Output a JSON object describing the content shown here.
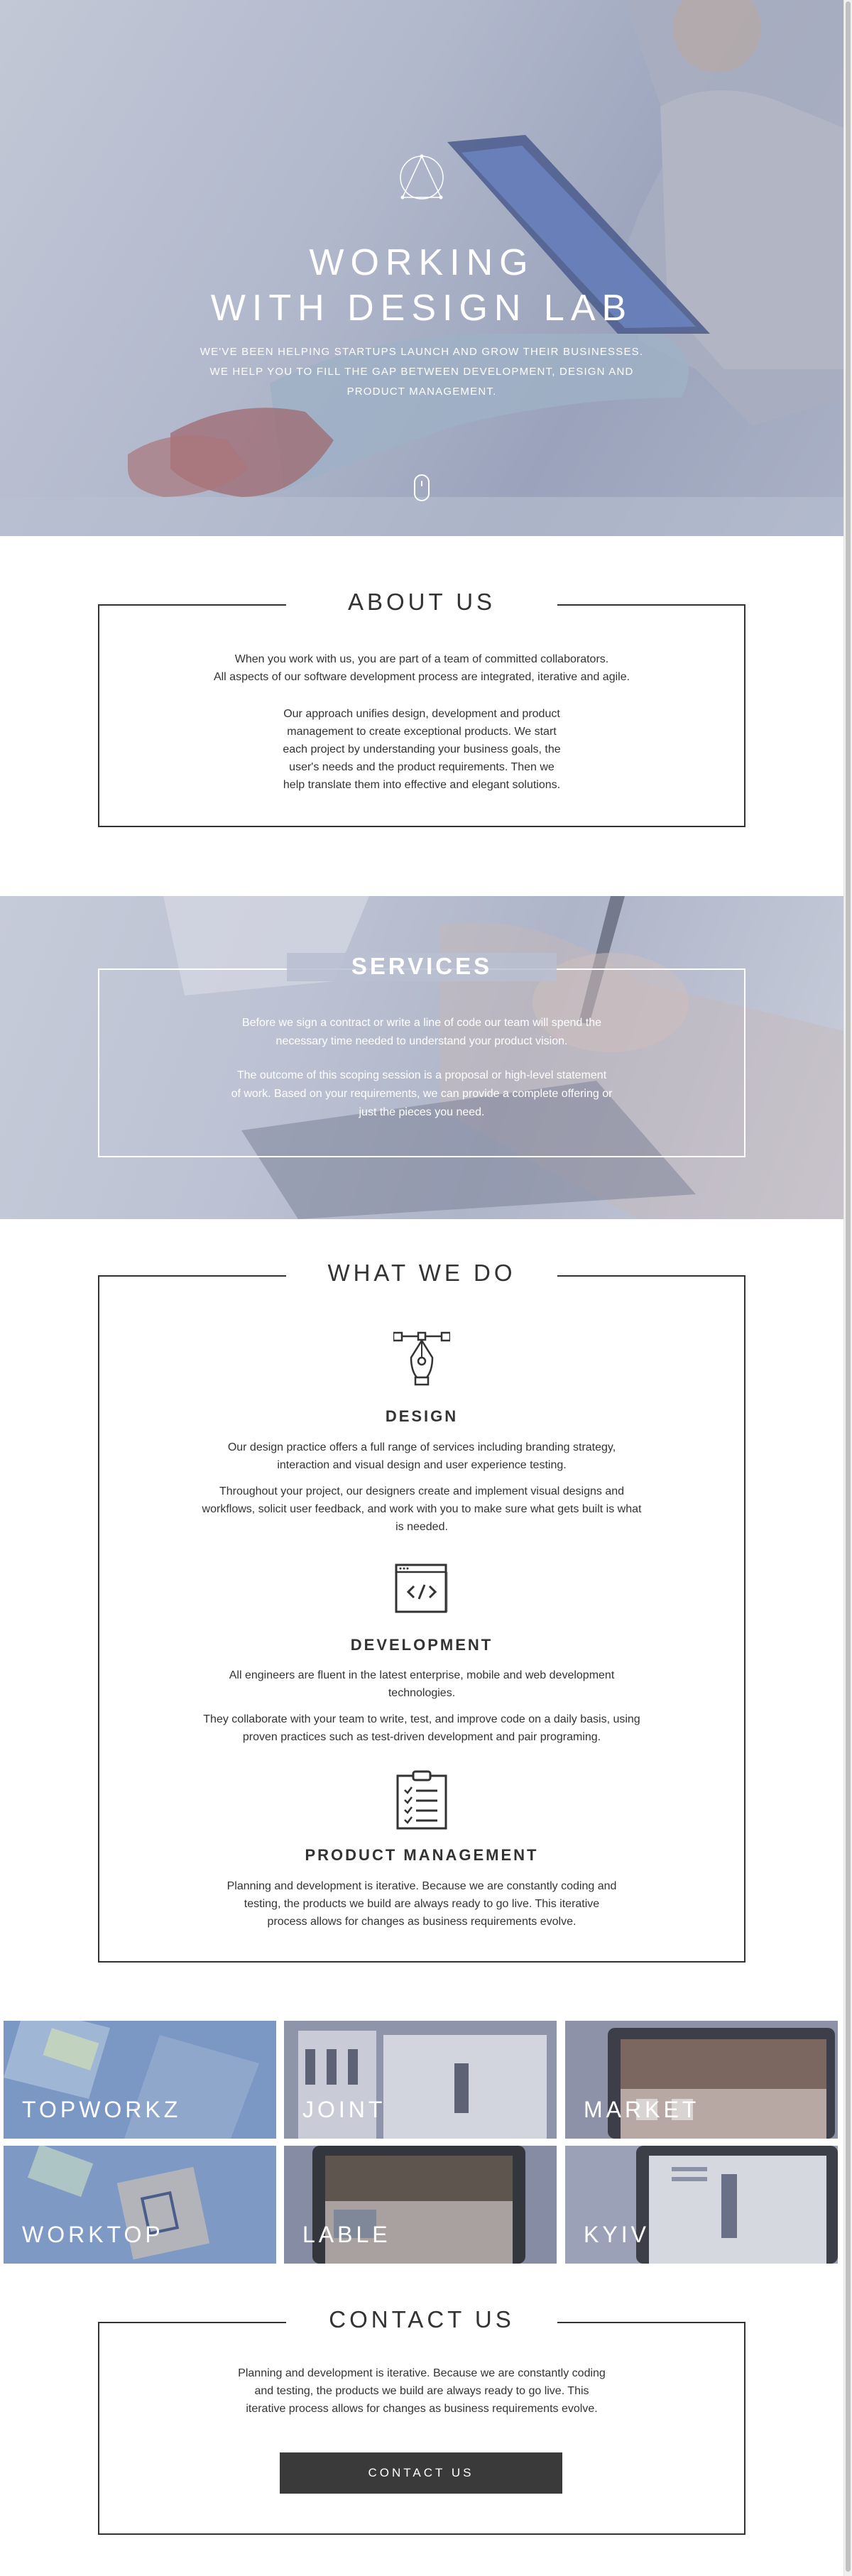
{
  "hero": {
    "title_line1": "WORKING",
    "title_line2": "WITH DESIGN LAB",
    "subtitle_line1": "WE'VE BEEN HELPING STARTUPS LAUNCH AND GROW THEIR BUSINESSES.",
    "subtitle_line2": "WE HELP YOU TO FILL THE GAP BETWEEN DEVELOPMENT, DESIGN AND",
    "subtitle_line3": "PRODUCT MANAGEMENT."
  },
  "about": {
    "title": "ABOUT US",
    "p1_line1": "When you work with us, you are part of a team of committed collaborators.",
    "p1_line2": "All aspects of our software development process are integrated, iterative and agile.",
    "p2_line1": "Our approach unifies design, development and product",
    "p2_line2": "management to create exceptional products. We start",
    "p2_line3": "each project by understanding your business goals, the",
    "p2_line4": "user's needs and the product requirements. Then we",
    "p2_line5": "help translate them into effective and elegant solutions."
  },
  "services": {
    "title": "SERVICES",
    "p1_line1": "Before we sign a contract or write a line of code our team will spend the",
    "p1_line2": "necessary time needed to understand your product vision.",
    "p2_line1": "The outcome of this scoping session is a proposal or high-level statement",
    "p2_line2": "of work. Based on your requirements, we can provide a complete offering or",
    "p2_line3": "just the pieces you need."
  },
  "what_we_do": {
    "title": "WHAT WE DO",
    "design": {
      "icon": "pen-tool-icon",
      "heading": "DESIGN",
      "p1_line1": "Our design practice offers a full range of services including branding strategy,",
      "p1_line2": "interaction and visual design and user experience testing.",
      "p2_line1": "Throughout your project, our designers create and implement visual designs and",
      "p2_line2": "workflows, solicit user feedback, and work with you to make sure what gets built is what",
      "p2_line3": "is needed."
    },
    "development": {
      "icon": "code-window-icon",
      "heading": "DEVELOPMENT",
      "p1_line1": "All engineers are fluent in the latest enterprise, mobile and web development",
      "p1_line2": "technologies.",
      "p2_line1": "They collaborate with your team to write, test, and improve code on a daily basis, using",
      "p2_line2": "proven practices such as test-driven development and pair programing."
    },
    "product": {
      "icon": "clipboard-checklist-icon",
      "heading": "PRODUCT MANAGEMENT",
      "p1_line1": "Planning and development is iterative. Because we are constantly coding and",
      "p1_line2": "testing, the products we build are always ready to go live. This iterative",
      "p1_line3": "process allows for changes as business requirements evolve."
    }
  },
  "portfolio": {
    "tiles": [
      {
        "label": "TOPWORKZ",
        "color": "#7b97c3"
      },
      {
        "label": "JOINT",
        "color": "#8e94a9"
      },
      {
        "label": "MARKET",
        "color": "#8d92a8"
      },
      {
        "label": "WORKTOP",
        "color": "#7f99c5"
      },
      {
        "label": "LABLE",
        "color": "#868ca3"
      },
      {
        "label": "KYIV",
        "color": "#9ba2b8"
      }
    ]
  },
  "contact": {
    "title": "CONTACT US",
    "p1_line1": "Planning and development is iterative. Because we are constantly coding",
    "p1_line2": "and testing, the products we build are always ready to go live. This",
    "p1_line3": "iterative process allows for changes as business requirements evolve.",
    "button": "CONTACT US"
  }
}
